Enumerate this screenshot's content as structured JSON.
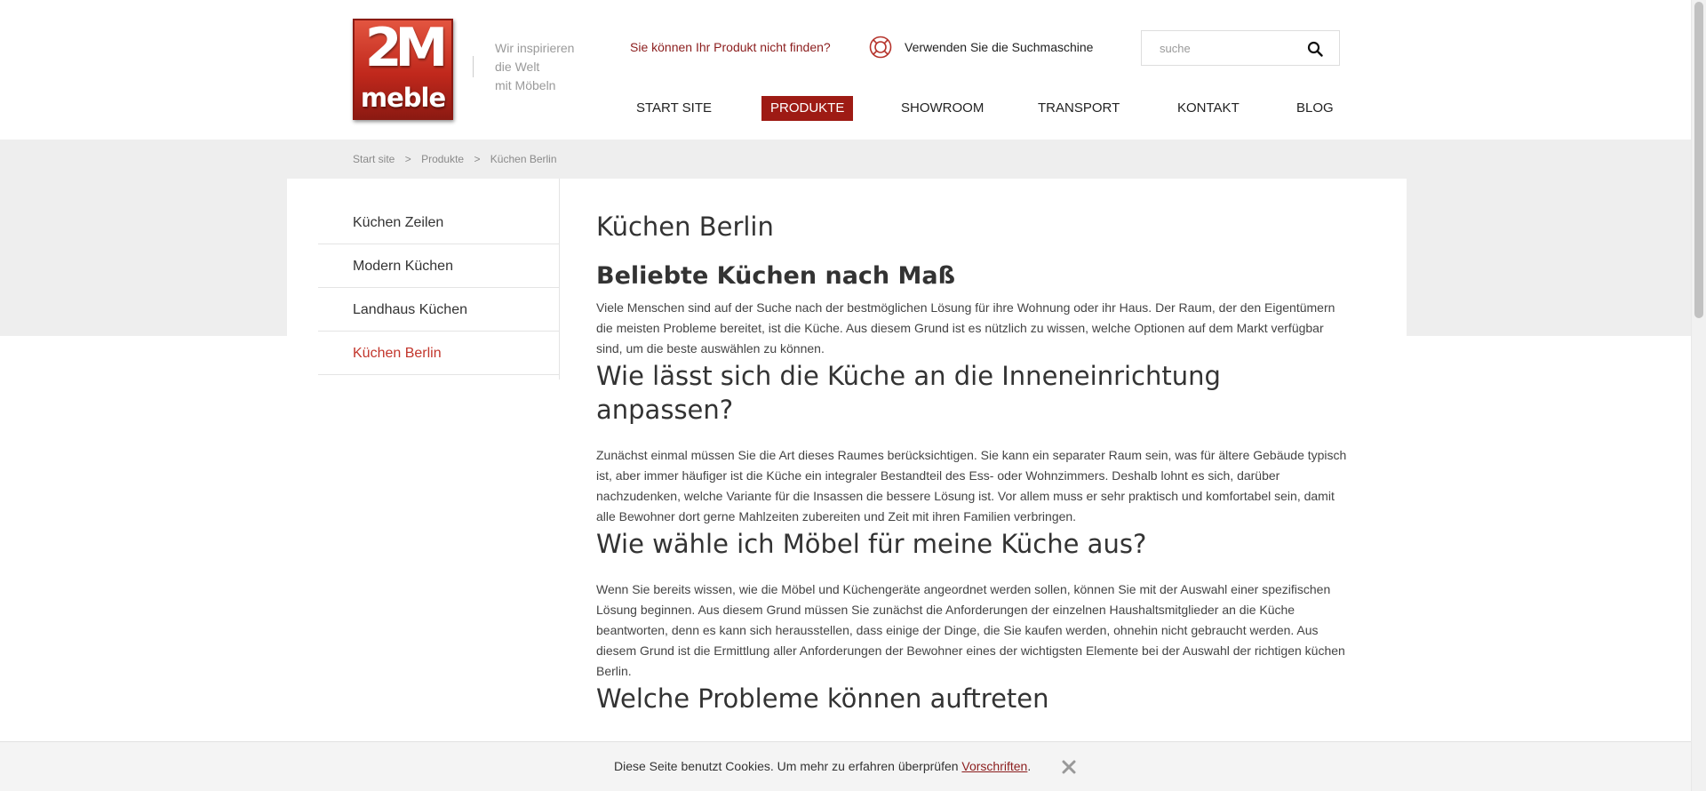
{
  "brand": {
    "logo_top": "2M",
    "logo_bottom": "meble",
    "tagline": [
      "Wir inspirieren",
      "die Welt",
      "mit Möbeln"
    ]
  },
  "header": {
    "not_found": "Sie können Ihr Produkt nicht finden?",
    "use_search": "Verwenden Sie die Suchmaschine",
    "search_placeholder": "suche",
    "search_value": ""
  },
  "nav": {
    "items": [
      {
        "label": "START SITE",
        "active": false
      },
      {
        "label": "PRODUKTE",
        "active": true
      },
      {
        "label": "SHOWROOM",
        "active": false
      },
      {
        "label": "TRANSPORT",
        "active": false
      },
      {
        "label": "KONTAKT",
        "active": false
      },
      {
        "label": "BLOG",
        "active": false
      }
    ]
  },
  "breadcrumb": [
    "Start site",
    "Produkte",
    "Küchen Berlin"
  ],
  "breadcrumb_sep": ">",
  "sidebar": {
    "items": [
      {
        "label": "Küchen Zeilen",
        "active": false
      },
      {
        "label": "Modern Küchen",
        "active": false
      },
      {
        "label": "Landhaus Küchen",
        "active": false
      },
      {
        "label": "Küchen Berlin",
        "active": true
      }
    ]
  },
  "main": {
    "title": "Küchen Berlin",
    "h1": "Beliebte Küchen nach Maß",
    "p1": "Viele Menschen sind auf der Suche nach der bestmöglichen Lösung für ihre Wohnung oder ihr Haus. Der Raum, der den Eigentümern die meisten Probleme bereitet, ist die Küche. Aus diesem Grund ist es nützlich zu wissen, welche Optionen auf dem Markt verfügbar sind, um die beste auswählen zu können.",
    "h2": "Wie lässt sich die Küche an die Inneneinrichtung anpassen?",
    "p2": "Zunächst einmal müssen Sie die Art dieses Raumes berücksichtigen. Sie kann ein separater Raum sein, was für ältere Gebäude typisch ist, aber immer häufiger ist die Küche ein integraler Bestandteil des Ess- oder Wohnzimmers. Deshalb lohnt es sich, darüber nachzudenken, welche Variante für die Insassen die bessere Lösung ist. Vor allem muss er sehr praktisch und komfortabel sein, damit alle Bewohner dort gerne Mahlzeiten zubereiten und Zeit mit ihren Familien verbringen.",
    "h3": "Wie wähle ich Möbel für meine Küche aus?",
    "p3": "Wenn Sie bereits wissen, wie die Möbel und Küchengeräte angeordnet werden sollen, können Sie mit der Auswahl einer spezifischen Lösung beginnen. Aus diesem Grund müssen Sie zunächst die Anforderungen der einzelnen Haushaltsmitglieder an die Küche beantworten, denn es kann sich herausstellen, dass einige der Dinge, die Sie kaufen werden, ohnehin nicht gebraucht werden. Aus diesem Grund ist die Ermittlung aller Anforderungen der Bewohner eines der wichtigsten Elemente bei der Auswahl der richtigen küchen Berlin.",
    "h4": "Welche Probleme können auftreten"
  },
  "cookie": {
    "text": "Diese Seite benutzt Cookies. Um mehr zu erfahren überprüfen ",
    "link": "Vorschriften",
    "suffix": "."
  },
  "colors": {
    "accent": "#9e1b14",
    "active_link": "#c2352b",
    "grey_band": "#eeeeee"
  },
  "icons": [
    "lifebuoy-icon",
    "search-icon",
    "close-icon"
  ]
}
